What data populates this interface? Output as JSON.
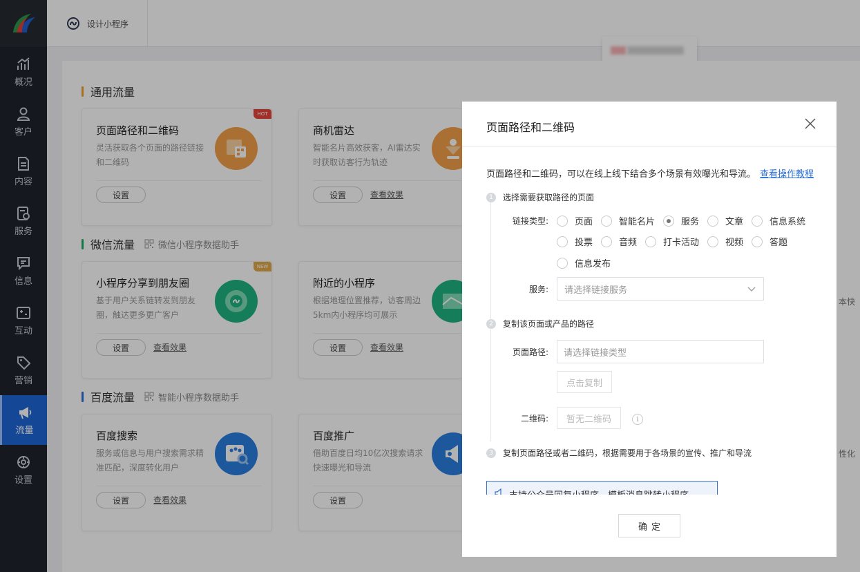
{
  "sidebar": {
    "items": [
      {
        "label": "概况",
        "icon": "chart-icon"
      },
      {
        "label": "客户",
        "icon": "user-icon"
      },
      {
        "label": "内容",
        "icon": "document-icon"
      },
      {
        "label": "服务",
        "icon": "service-icon"
      },
      {
        "label": "信息",
        "icon": "message-icon"
      },
      {
        "label": "互动",
        "icon": "interaction-icon"
      },
      {
        "label": "营销",
        "icon": "tag-icon"
      },
      {
        "label": "流量",
        "icon": "megaphone-icon"
      },
      {
        "label": "设置",
        "icon": "gear-icon"
      }
    ],
    "active_index": 7
  },
  "header": {
    "tab_label": "设计小程序"
  },
  "sections": {
    "general": {
      "title": "通用流量",
      "color": "#f0a030"
    },
    "wechat": {
      "title": "微信流量",
      "subtitle": "微信小程序数据助手",
      "color": "#1aad6c"
    },
    "baidu": {
      "title": "百度流量",
      "subtitle": "智能小程序数据助手",
      "color": "#2b6fd6"
    }
  },
  "cards": [
    {
      "title": "页面路径和二维码",
      "desc": "灵活获取各个页面的路径链接和二维码",
      "button": "设置",
      "tag": "HOT",
      "icon": "qrcode-icon",
      "color": "#f0a040"
    },
    {
      "title": "商机雷达",
      "desc": "智能名片高效获客，AI雷达实时获取访客行为轨迹",
      "button": "设置",
      "link": "查看效果",
      "icon": "radar-icon",
      "color": "#f0a040"
    },
    {
      "title": "小程序分享到朋友圈",
      "desc": "基于用户关系链转发到朋友圈，触达更多更广客户",
      "button": "设置",
      "link": "查看效果",
      "tag": "NEW",
      "icon": "moments-icon",
      "color": "#1fb381"
    },
    {
      "title": "附近的小程序",
      "desc": "根据地理位置推荐，访客周边5km内小程序均可展示",
      "button": "设置",
      "link": "查看效果",
      "icon": "map-icon",
      "color": "#1fb381"
    },
    {
      "title": "百度搜索",
      "desc": "服务或信息与用户搜索需求精准匹配，深度转化用户",
      "button": "设置",
      "link": "查看效果",
      "icon": "baidu-search-icon",
      "color": "#2b7fe0"
    },
    {
      "title": "百度推广",
      "desc": "借助百度日均10亿次搜索请求快速曝光和导流",
      "button": "设置",
      "icon": "baidu-promote-icon",
      "color": "#2b7fe0"
    }
  ],
  "edge_texts": [
    "本快",
    "性化"
  ],
  "modal": {
    "title": "页面路径和二维码",
    "intro": "页面路径和二维码，可以在线上线下结合多个场景有效曝光和导流。",
    "intro_link": "查看操作教程",
    "step1": "选择需要获取路径的页面",
    "step2": "复制该页面或产品的路径",
    "step3": "复制页面路径或者二维码，根据需要用于各场景的宣传、推广和导流",
    "link_type_label": "链接类型:",
    "link_types": [
      "页面",
      "智能名片",
      "服务",
      "文章",
      "信息系统",
      "投票",
      "音频",
      "打卡活动",
      "视频",
      "答题",
      "信息发布"
    ],
    "selected_link_type": "服务",
    "service_label": "服务:",
    "service_placeholder": "请选择链接服务",
    "path_label": "页面路径:",
    "path_placeholder": "请选择链接类型",
    "copy_button": "点击复制",
    "qrcode_label": "二维码:",
    "qrcode_button": "暂无二维码",
    "info_glyph": "i",
    "notice_text": "支持公众号回复小程序、模板消息跳转小程序",
    "ok_button": "确定"
  }
}
